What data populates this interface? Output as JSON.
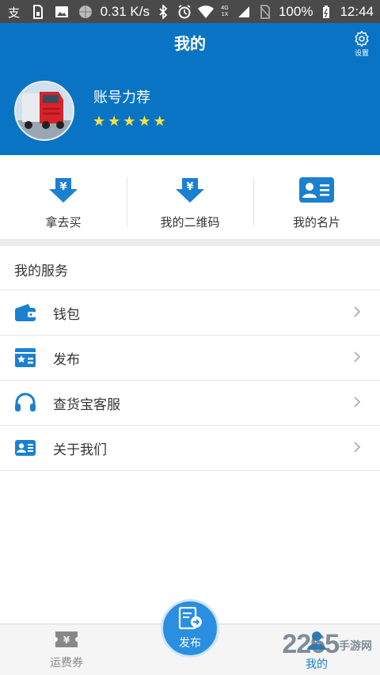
{
  "status_bar": {
    "speed": "0.31 K/s",
    "battery": "100%",
    "time": "12:44",
    "net_top": "4G",
    "net_bottom": "1X"
  },
  "header": {
    "title": "我的",
    "settings_label": "设置",
    "username": "账号力荐",
    "rating": 5
  },
  "shortcuts": [
    {
      "label": "拿去买",
      "icon": "yuan-download-icon"
    },
    {
      "label": "我的二维码",
      "icon": "yuan-download-icon"
    },
    {
      "label": "我的名片",
      "icon": "business-card-icon"
    }
  ],
  "services": {
    "title": "我的服务",
    "items": [
      {
        "label": "钱包",
        "icon": "wallet-icon"
      },
      {
        "label": "发布",
        "icon": "publish-card-icon"
      },
      {
        "label": "查货宝客服",
        "icon": "headset-icon"
      },
      {
        "label": "关于我们",
        "icon": "contact-card-icon"
      }
    ]
  },
  "tabbar": {
    "left": "运费券",
    "center": "发布",
    "right": "我的"
  },
  "watermark": {
    "number": "2265",
    "suffix": "手游网"
  },
  "colors": {
    "brand": "#0a74c4",
    "accent": "#1b80d0",
    "star": "#ffe33a"
  }
}
